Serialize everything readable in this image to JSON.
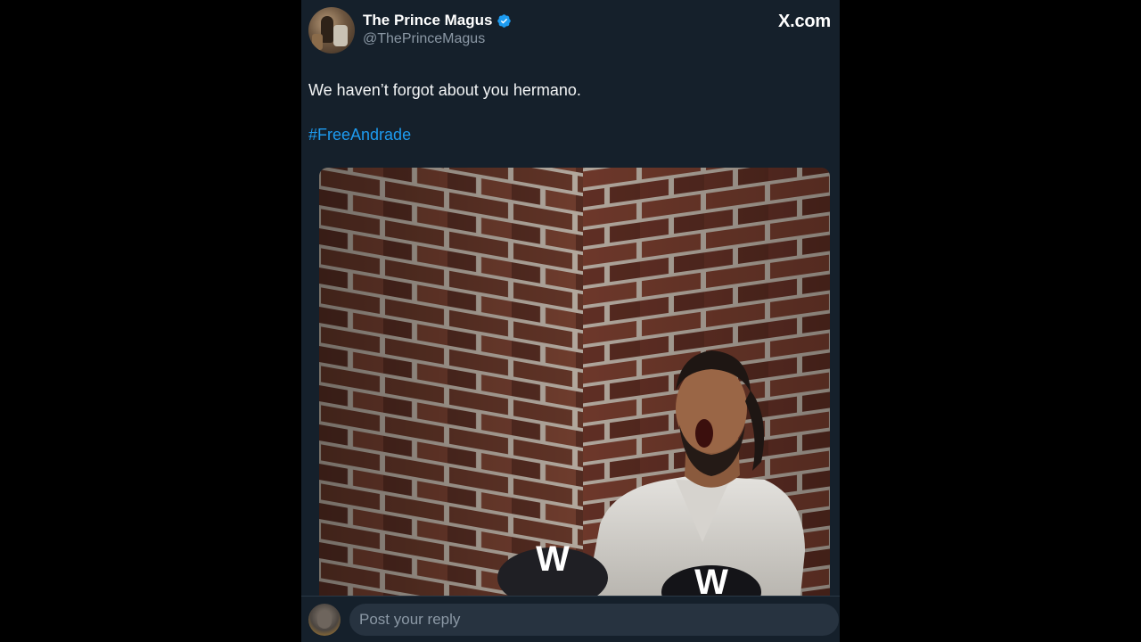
{
  "author": {
    "name": "The Prince Magus",
    "handle": "@ThePrinceMagus",
    "verified": true
  },
  "site_label": "X.com",
  "tweet": {
    "text": "We haven’t forgot about you hermano.",
    "hashtag": "#FreeAndrade"
  },
  "media": {
    "description_icon": "image",
    "logo_mark": "W"
  },
  "reply": {
    "placeholder": "Post your reply"
  },
  "colors": {
    "background": "#15202b",
    "accent": "#1d9bf0",
    "text": "#ffffff",
    "muted": "#8b98a5",
    "input_bg": "#273340"
  }
}
